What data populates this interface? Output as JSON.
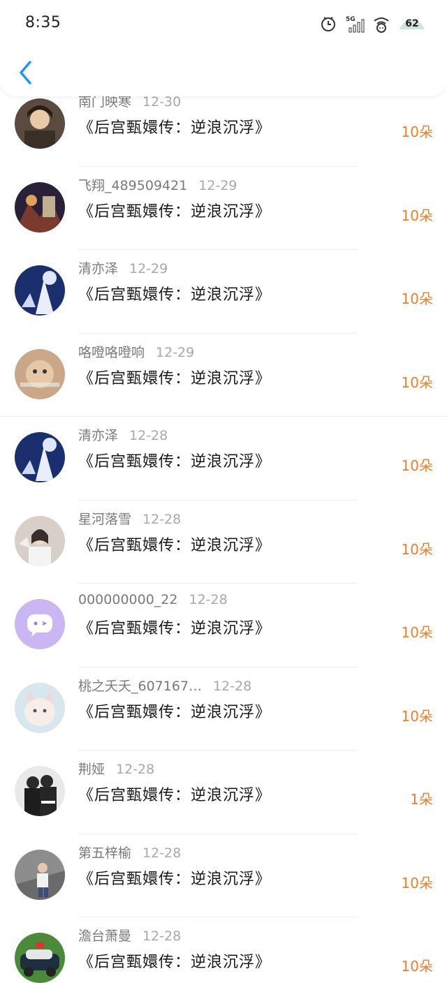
{
  "status_bar": {
    "time": "8:35",
    "network": "5G",
    "battery": "62"
  },
  "colors": {
    "accent": "#2196f3",
    "gift": "#f07e2b"
  },
  "header": {
    "back_icon": "chevron-left-icon"
  },
  "items": [
    {
      "name": "南门映寒",
      "date": "12-30",
      "title": "《后宫甄嬛传：逆浪沉浮》",
      "gift": "10朵"
    },
    {
      "name": "飞翔_489509421",
      "date": "12-29",
      "title": "《后宫甄嬛传：逆浪沉浮》",
      "gift": "10朵"
    },
    {
      "name": "清亦泽",
      "date": "12-29",
      "title": "《后宫甄嬛传：逆浪沉浮》",
      "gift": "10朵"
    },
    {
      "name": "咯噔咯噔响",
      "date": "12-29",
      "title": "《后宫甄嬛传：逆浪沉浮》",
      "gift": "10朵"
    },
    {
      "name": "清亦泽",
      "date": "12-28",
      "title": "《后宫甄嬛传：逆浪沉浮》",
      "gift": "10朵"
    },
    {
      "name": "星河落雪",
      "date": "12-28",
      "title": "《后宫甄嬛传：逆浪沉浮》",
      "gift": "10朵"
    },
    {
      "name": "000000000_22",
      "date": "12-28",
      "title": "《后宫甄嬛传：逆浪沉浮》",
      "gift": "10朵"
    },
    {
      "name": "桃之夭夭_607167…",
      "date": "12-28",
      "title": "《后宫甄嬛传：逆浪沉浮》",
      "gift": "10朵"
    },
    {
      "name": "荆娅",
      "date": "12-28",
      "title": "《后宫甄嬛传：逆浪沉浮》",
      "gift": "1朵"
    },
    {
      "name": "第五梓榆",
      "date": "12-28",
      "title": "《后宫甄嬛传：逆浪沉浮》",
      "gift": "10朵"
    },
    {
      "name": "澹台萧曼",
      "date": "12-28",
      "title": "《后宫甄嬛传：逆浪沉浮》",
      "gift": "10朵"
    }
  ]
}
